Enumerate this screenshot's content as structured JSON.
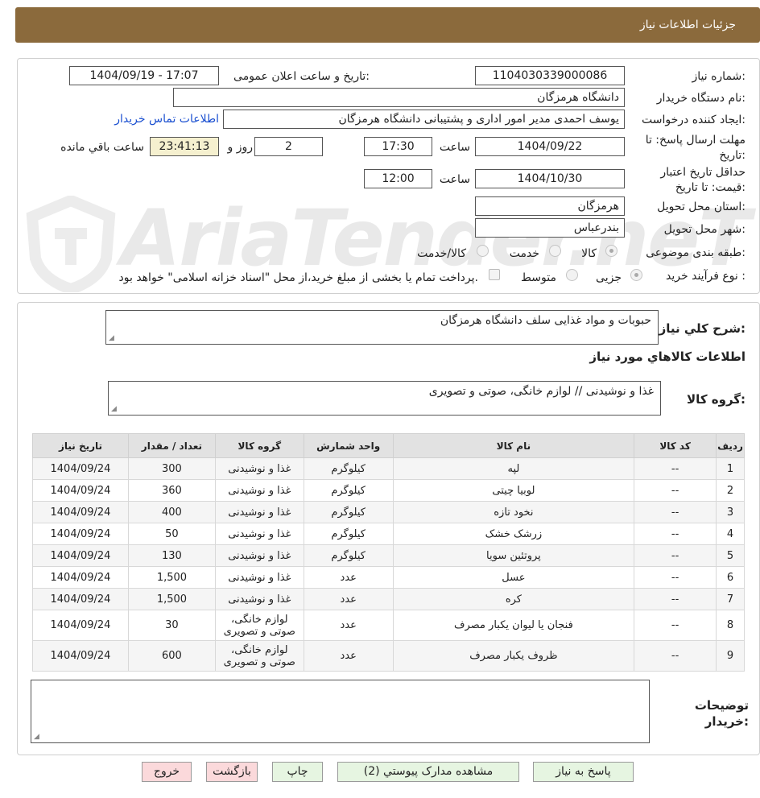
{
  "header": {
    "title": "جزئیات اطلاعات نیاز"
  },
  "watermark": {
    "text": "AriaTender.neT"
  },
  "form": {
    "need_number_label": "شماره نیاز:",
    "need_number": "1104030339000086",
    "announce_label": "تاریخ و ساعت اعلان عمومی:",
    "announce_value": "1404/09/19 - 17:07",
    "buyer_org_label": "نام دستگاه خریدار:",
    "buyer_org": "دانشگاه هرمزگان",
    "requester_label": "ایجاد کننده درخواست:",
    "requester": "یوسف احمدی مدیر امور اداری و پشتیبانی دانشگاه هرمزگان",
    "contact_link": "اطلاعات تماس خریدار",
    "deadline_label": "مهلت ارسال پاسخ: تا تاریخ:",
    "deadline_date": "1404/09/22",
    "time_label": "ساعت",
    "deadline_time": "17:30",
    "days_value": "2",
    "days_label": "روز و",
    "remaining_time": "23:41:13",
    "remaining_label": "ساعت باقي مانده",
    "validity_label": "حداقل تاریخ اعتبار قیمت: تا تاریخ:",
    "validity_date": "1404/10/30",
    "validity_time": "12:00",
    "province_label": "استان محل تحویل:",
    "province": "هرمزگان",
    "city_label": "شهر محل تحویل:",
    "city": "بندرعباس",
    "category_label": "طبقه بندی موضوعی:",
    "category_options": [
      "کالا",
      "خدمت",
      "کالا/خدمت"
    ],
    "process_label": "نوع فرآیند خرید :",
    "process_options": [
      "جزیی",
      "متوسط"
    ],
    "payment_note": "پرداخت تمام یا بخشی از مبلغ خرید،از محل \"اسناد خزانه اسلامی\" خواهد بود."
  },
  "summary": {
    "desc_label": "شرح کلي نیاز:",
    "desc_value": "حبوبات و مواد غذایی سلف دانشگاه هرمزگان",
    "goods_info_title": "اطلاعات کالاهاي مورد نیاز",
    "goods_group_label": "گروه کالا:",
    "goods_group_value": "غذا و نوشیدنی // لوازم خانگی، صوتی و تصویری"
  },
  "table": {
    "headers": [
      "ردیف",
      "کد کالا",
      "نام کالا",
      "واحد شمارش",
      "گروه کالا",
      "تعداد / مقدار",
      "تاریخ نیاز"
    ],
    "rows": [
      [
        "1",
        "--",
        "لپه",
        "کیلوگرم",
        "غذا و نوشیدنی",
        "300",
        "1404/09/24"
      ],
      [
        "2",
        "--",
        "لوبیا چیتی",
        "کیلوگرم",
        "غذا و نوشیدنی",
        "360",
        "1404/09/24"
      ],
      [
        "3",
        "--",
        "نخود تازه",
        "کیلوگرم",
        "غذا و نوشیدنی",
        "400",
        "1404/09/24"
      ],
      [
        "4",
        "--",
        "زرشک خشک",
        "کیلوگرم",
        "غذا و نوشیدنی",
        "50",
        "1404/09/24"
      ],
      [
        "5",
        "--",
        "پروتئین سویا",
        "کیلوگرم",
        "غذا و نوشیدنی",
        "130",
        "1404/09/24"
      ],
      [
        "6",
        "--",
        "عسل",
        "عدد",
        "غذا و نوشیدنی",
        "1,500",
        "1404/09/24"
      ],
      [
        "7",
        "--",
        "کره",
        "عدد",
        "غذا و نوشیدنی",
        "1,500",
        "1404/09/24"
      ],
      [
        "8",
        "--",
        "فنجان یا لیوان یکبار مصرف",
        "عدد",
        "لوازم خانگی، صوتی و تصویری",
        "30",
        "1404/09/24"
      ],
      [
        "9",
        "--",
        "ظروف یکبار مصرف",
        "عدد",
        "لوازم خانگی، صوتی و تصویری",
        "600",
        "1404/09/24"
      ]
    ]
  },
  "notes": {
    "label": "توضیحات خریدار:",
    "value": ""
  },
  "buttons": {
    "reply": "پاسخ به نیاز",
    "attachments": "مشاهده مدارک پیوستي (2)",
    "print": "چاپ",
    "back": "بازگشت",
    "exit": "خروج"
  }
}
